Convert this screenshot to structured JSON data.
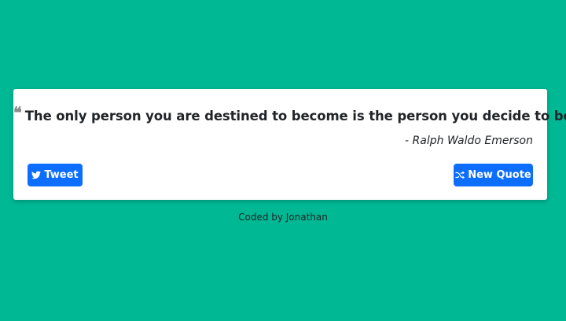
{
  "colors": {
    "background": "#00b894",
    "card": "#ffffff",
    "button": "#0d6efd",
    "text": "#212529",
    "quote_marks": "#8a8a8a"
  },
  "quote": {
    "text": "The only person you are destined to become is the person you decide to be.",
    "author": "- Ralph Waldo Emerson",
    "open_mark": "❝",
    "close_mark": "❞"
  },
  "buttons": {
    "tweet": {
      "label": "Tweet",
      "icon": "twitter-icon"
    },
    "new_quote": {
      "label": "New Quote",
      "icon": "shuffle-icon"
    }
  },
  "footer": {
    "text": "Coded by Jonathan"
  }
}
